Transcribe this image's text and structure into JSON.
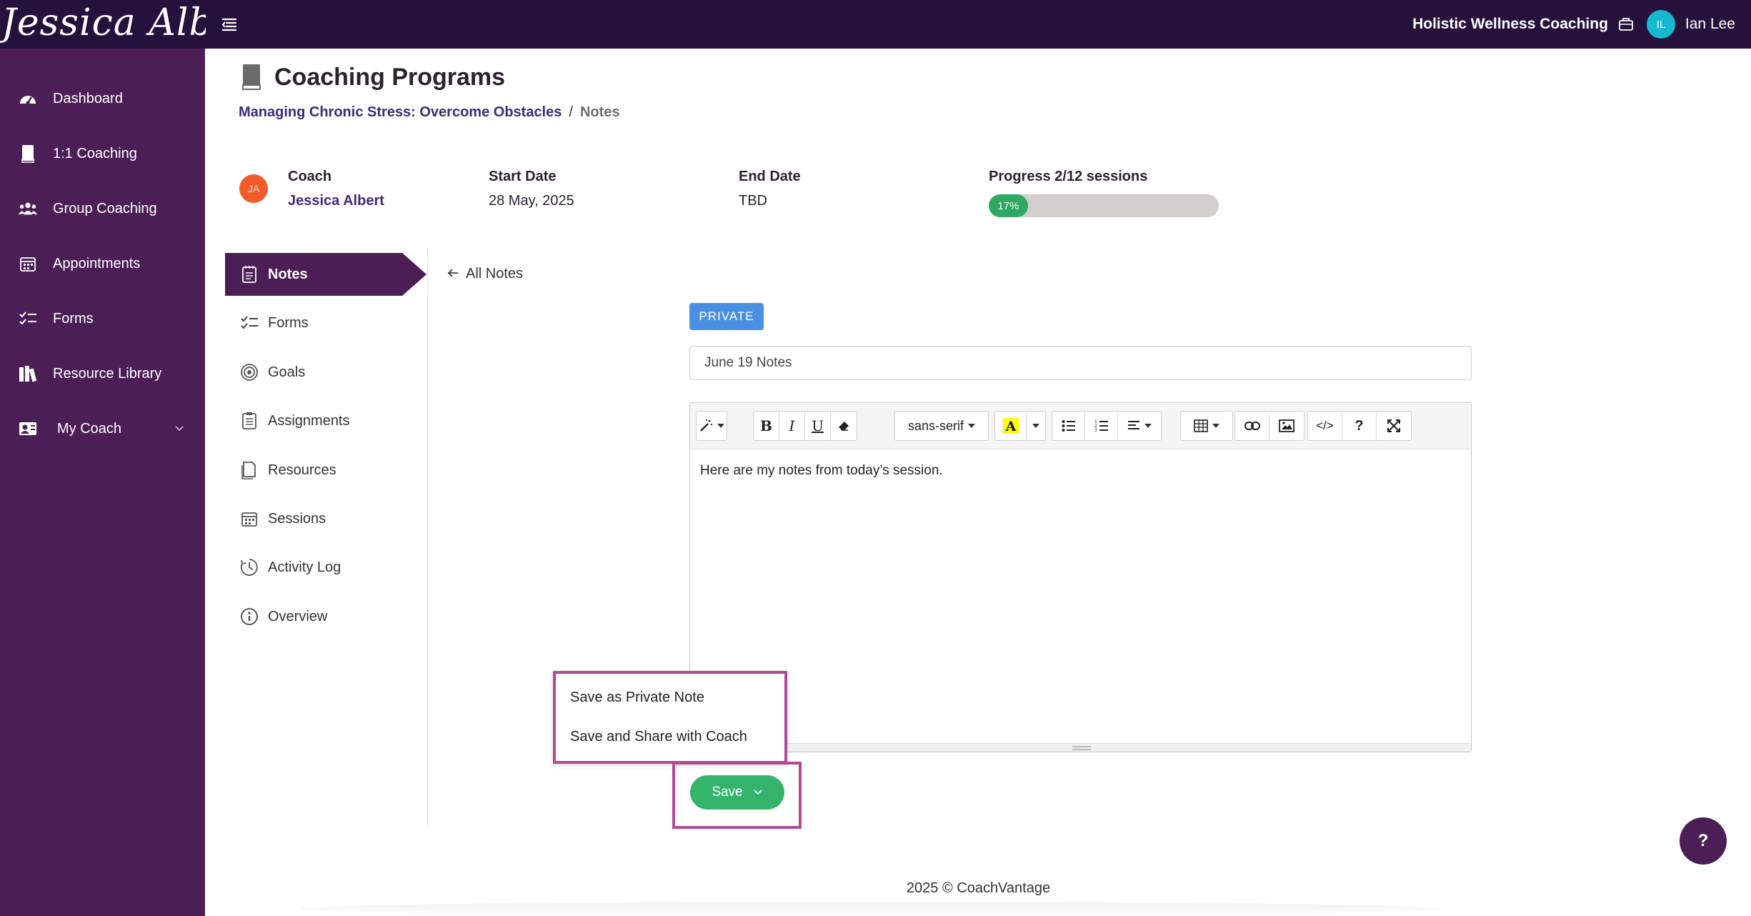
{
  "topbar": {
    "brand": "Jessica Albert",
    "org_name": "Holistic Wellness Coaching",
    "user_initials": "IL",
    "user_name": "Ian Lee"
  },
  "sidebar": {
    "items": [
      {
        "label": "Dashboard",
        "icon": "dashboard-icon"
      },
      {
        "label": "1:1 Coaching",
        "icon": "book-icon"
      },
      {
        "label": "Group Coaching",
        "icon": "users-icon"
      },
      {
        "label": "Appointments",
        "icon": "calendar-icon"
      },
      {
        "label": "Forms",
        "icon": "checklist-icon"
      },
      {
        "label": "Resource Library",
        "icon": "library-icon"
      },
      {
        "label": "My Coach",
        "icon": "coach-icon"
      }
    ]
  },
  "page": {
    "title": "Coaching Programs",
    "breadcrumb_link": "Managing Chronic Stress: Overcome Obstacles",
    "breadcrumb_sep": "/",
    "breadcrumb_current": "Notes"
  },
  "info": {
    "coach_label": "Coach",
    "coach_initials": "JA",
    "coach_name": "Jessica Albert",
    "start_label": "Start Date",
    "start_value": "28 May, 2025",
    "end_label": "End Date",
    "end_value": "TBD",
    "progress_label": "Progress 2/12 sessions",
    "progress_text": "17%",
    "progress_fraction": 0.17
  },
  "subnav": {
    "items": [
      {
        "label": "Notes",
        "icon": "notes-icon"
      },
      {
        "label": "Forms",
        "icon": "checklist-icon"
      },
      {
        "label": "Goals",
        "icon": "target-icon"
      },
      {
        "label": "Assignments",
        "icon": "clipboard-icon"
      },
      {
        "label": "Resources",
        "icon": "document-icon"
      },
      {
        "label": "Sessions",
        "icon": "calendar-icon"
      },
      {
        "label": "Activity Log",
        "icon": "clock-icon"
      },
      {
        "label": "Overview",
        "icon": "info-icon"
      }
    ],
    "active": "Notes"
  },
  "note": {
    "back_label": "All Notes",
    "badge": "PRIVATE",
    "title_value": "June 19 Notes",
    "font_family_label": "sans-serif",
    "content": "Here are my notes from today’s session.",
    "highlight_color": "#ffff00"
  },
  "save": {
    "label": "Save",
    "options": [
      "Save as Private Note",
      "Save and Share with Coach"
    ]
  },
  "help_label": "?",
  "footer": "2025 © CoachVantage",
  "colors": {
    "topbar": "#26113d",
    "sidebar": "#4b1f56",
    "active_nav": "#4b1f56",
    "save_green": "#34b46b",
    "highlight_frame": "#b04b91",
    "badge_blue": "#4a90e2"
  }
}
